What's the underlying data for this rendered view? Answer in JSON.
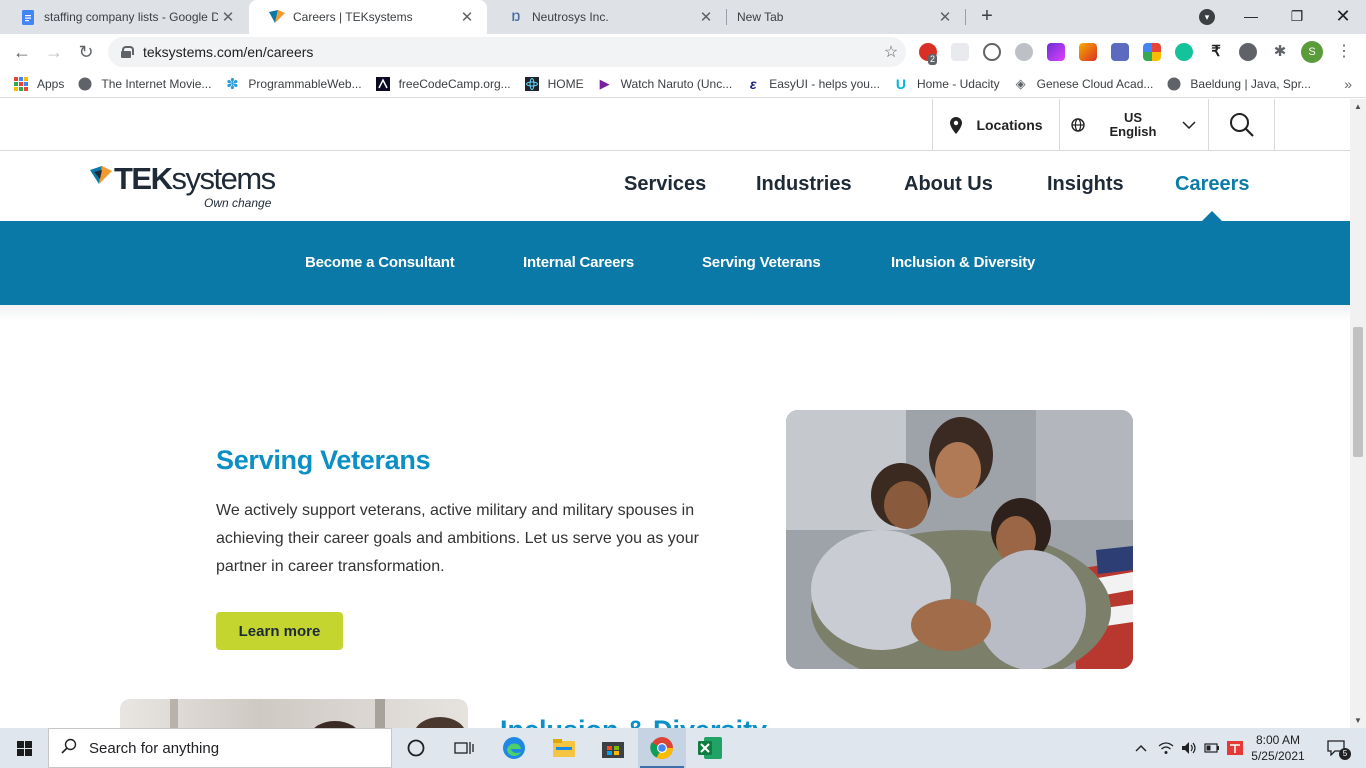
{
  "browser": {
    "tabs": [
      {
        "title": "staffing company lists - Google D",
        "icon": "google-docs-icon"
      },
      {
        "title": "Careers | TEKsystems",
        "icon": "teksystems-icon"
      },
      {
        "title": "Neutrosys Inc.",
        "icon": "neutrosys-icon"
      },
      {
        "title": "New Tab",
        "icon": ""
      }
    ],
    "url": "teksystems.com/en/careers",
    "extension_badge": "2",
    "profile_initial": "S",
    "bookmarks": [
      "Apps",
      "The Internet Movie...",
      "ProgrammableWeb...",
      "freeCodeCamp.org...",
      "HOME",
      "Watch Naruto (Unc...",
      "EasyUI - helps you...",
      "Home - Udacity",
      "Genese Cloud Acad...",
      "Baeldung | Java, Spr..."
    ]
  },
  "site": {
    "utility": {
      "locations": "Locations",
      "lang_line1": "US",
      "lang_line2": "English"
    },
    "logo": {
      "bold": "TEK",
      "light": "systems",
      "tagline": "Own change"
    },
    "nav": [
      "Services",
      "Industries",
      "About Us",
      "Insights",
      "Careers"
    ],
    "subnav": [
      "Become a Consultant",
      "Internal Careers",
      "Serving Veterans",
      "Inclusion & Diversity"
    ],
    "veterans": {
      "title": "Serving Veterans",
      "text": "We actively support veterans, active military and military spouses in achieving their career goals and ambitions. Let us serve you as your partner in career transformation.",
      "button": "Learn more"
    },
    "next_section_title": "Inclusion & Diversity"
  },
  "taskbar": {
    "search_placeholder": "Search for anything",
    "time": "8:00 AM",
    "date": "5/25/2021",
    "notification_count": "5"
  },
  "colors": {
    "brand_blue": "#0b79a8",
    "heading_blue": "#0b8fc5",
    "cta_green": "#c5d52f",
    "navy": "#1f2a37"
  }
}
